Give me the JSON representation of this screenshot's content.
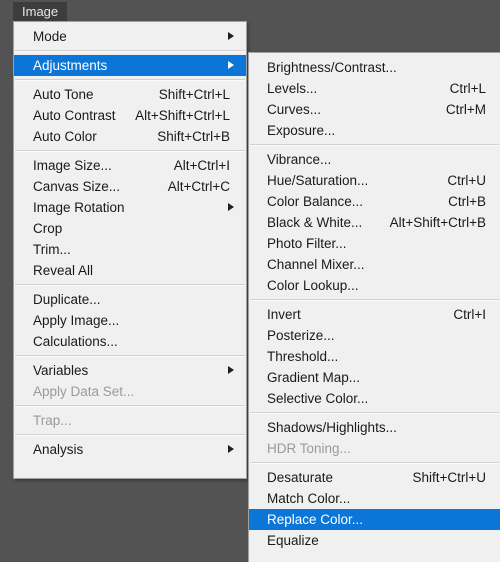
{
  "app": {
    "background_color": "#535353",
    "accent_color": "#0c76d8",
    "menu_background": "#f0f0f0",
    "menubar_title": "Image"
  },
  "main_menu": {
    "name": "Image",
    "items": [
      {
        "type": "item",
        "label": "Mode",
        "accel": "",
        "submenu": true,
        "selected": false,
        "disabled": false
      },
      {
        "type": "separator"
      },
      {
        "type": "item",
        "label": "Adjustments",
        "accel": "",
        "submenu": true,
        "selected": true,
        "disabled": false
      },
      {
        "type": "separator"
      },
      {
        "type": "item",
        "label": "Auto Tone",
        "accel": "Shift+Ctrl+L",
        "submenu": false,
        "selected": false,
        "disabled": false
      },
      {
        "type": "item",
        "label": "Auto Contrast",
        "accel": "Alt+Shift+Ctrl+L",
        "submenu": false,
        "selected": false,
        "disabled": false
      },
      {
        "type": "item",
        "label": "Auto Color",
        "accel": "Shift+Ctrl+B",
        "submenu": false,
        "selected": false,
        "disabled": false
      },
      {
        "type": "separator"
      },
      {
        "type": "item",
        "label": "Image Size...",
        "accel": "Alt+Ctrl+I",
        "submenu": false,
        "selected": false,
        "disabled": false
      },
      {
        "type": "item",
        "label": "Canvas Size...",
        "accel": "Alt+Ctrl+C",
        "submenu": false,
        "selected": false,
        "disabled": false
      },
      {
        "type": "item",
        "label": "Image Rotation",
        "accel": "",
        "submenu": true,
        "selected": false,
        "disabled": false
      },
      {
        "type": "item",
        "label": "Crop",
        "accel": "",
        "submenu": false,
        "selected": false,
        "disabled": false
      },
      {
        "type": "item",
        "label": "Trim...",
        "accel": "",
        "submenu": false,
        "selected": false,
        "disabled": false
      },
      {
        "type": "item",
        "label": "Reveal All",
        "accel": "",
        "submenu": false,
        "selected": false,
        "disabled": false
      },
      {
        "type": "separator"
      },
      {
        "type": "item",
        "label": "Duplicate...",
        "accel": "",
        "submenu": false,
        "selected": false,
        "disabled": false
      },
      {
        "type": "item",
        "label": "Apply Image...",
        "accel": "",
        "submenu": false,
        "selected": false,
        "disabled": false
      },
      {
        "type": "item",
        "label": "Calculations...",
        "accel": "",
        "submenu": false,
        "selected": false,
        "disabled": false
      },
      {
        "type": "separator"
      },
      {
        "type": "item",
        "label": "Variables",
        "accel": "",
        "submenu": true,
        "selected": false,
        "disabled": false
      },
      {
        "type": "item",
        "label": "Apply Data Set...",
        "accel": "",
        "submenu": false,
        "selected": false,
        "disabled": true
      },
      {
        "type": "separator"
      },
      {
        "type": "item",
        "label": "Trap...",
        "accel": "",
        "submenu": false,
        "selected": false,
        "disabled": true
      },
      {
        "type": "separator"
      },
      {
        "type": "item",
        "label": "Analysis",
        "accel": "",
        "submenu": true,
        "selected": false,
        "disabled": false
      }
    ]
  },
  "sub_menu": {
    "name": "Adjustments",
    "items": [
      {
        "type": "item",
        "label": "Brightness/Contrast...",
        "accel": "",
        "submenu": false,
        "selected": false,
        "disabled": false
      },
      {
        "type": "item",
        "label": "Levels...",
        "accel": "Ctrl+L",
        "submenu": false,
        "selected": false,
        "disabled": false
      },
      {
        "type": "item",
        "label": "Curves...",
        "accel": "Ctrl+M",
        "submenu": false,
        "selected": false,
        "disabled": false
      },
      {
        "type": "item",
        "label": "Exposure...",
        "accel": "",
        "submenu": false,
        "selected": false,
        "disabled": false
      },
      {
        "type": "separator"
      },
      {
        "type": "item",
        "label": "Vibrance...",
        "accel": "",
        "submenu": false,
        "selected": false,
        "disabled": false
      },
      {
        "type": "item",
        "label": "Hue/Saturation...",
        "accel": "Ctrl+U",
        "submenu": false,
        "selected": false,
        "disabled": false
      },
      {
        "type": "item",
        "label": "Color Balance...",
        "accel": "Ctrl+B",
        "submenu": false,
        "selected": false,
        "disabled": false
      },
      {
        "type": "item",
        "label": "Black & White...",
        "accel": "Alt+Shift+Ctrl+B",
        "submenu": false,
        "selected": false,
        "disabled": false
      },
      {
        "type": "item",
        "label": "Photo Filter...",
        "accel": "",
        "submenu": false,
        "selected": false,
        "disabled": false
      },
      {
        "type": "item",
        "label": "Channel Mixer...",
        "accel": "",
        "submenu": false,
        "selected": false,
        "disabled": false
      },
      {
        "type": "item",
        "label": "Color Lookup...",
        "accel": "",
        "submenu": false,
        "selected": false,
        "disabled": false
      },
      {
        "type": "separator"
      },
      {
        "type": "item",
        "label": "Invert",
        "accel": "Ctrl+I",
        "submenu": false,
        "selected": false,
        "disabled": false
      },
      {
        "type": "item",
        "label": "Posterize...",
        "accel": "",
        "submenu": false,
        "selected": false,
        "disabled": false
      },
      {
        "type": "item",
        "label": "Threshold...",
        "accel": "",
        "submenu": false,
        "selected": false,
        "disabled": false
      },
      {
        "type": "item",
        "label": "Gradient Map...",
        "accel": "",
        "submenu": false,
        "selected": false,
        "disabled": false
      },
      {
        "type": "item",
        "label": "Selective Color...",
        "accel": "",
        "submenu": false,
        "selected": false,
        "disabled": false
      },
      {
        "type": "separator"
      },
      {
        "type": "item",
        "label": "Shadows/Highlights...",
        "accel": "",
        "submenu": false,
        "selected": false,
        "disabled": false
      },
      {
        "type": "item",
        "label": "HDR Toning...",
        "accel": "",
        "submenu": false,
        "selected": false,
        "disabled": true
      },
      {
        "type": "separator"
      },
      {
        "type": "item",
        "label": "Desaturate",
        "accel": "Shift+Ctrl+U",
        "submenu": false,
        "selected": false,
        "disabled": false
      },
      {
        "type": "item",
        "label": "Match Color...",
        "accel": "",
        "submenu": false,
        "selected": false,
        "disabled": false
      },
      {
        "type": "item",
        "label": "Replace Color...",
        "accel": "",
        "submenu": false,
        "selected": true,
        "disabled": false
      },
      {
        "type": "item",
        "label": "Equalize",
        "accel": "",
        "submenu": false,
        "selected": false,
        "disabled": false
      }
    ]
  }
}
